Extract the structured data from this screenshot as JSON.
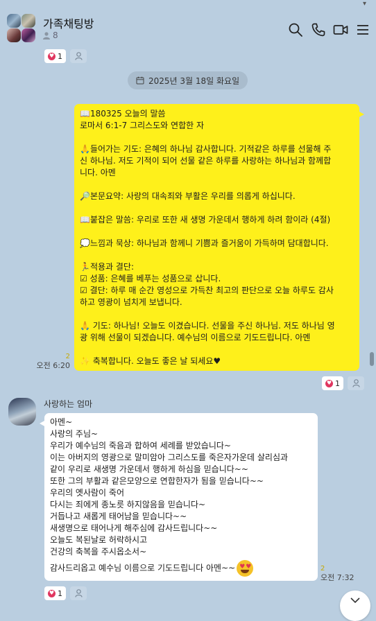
{
  "header": {
    "title": "가족채팅방",
    "member_count": "8",
    "top_scroll_glyph": "▾",
    "icons": [
      "search-icon",
      "phone-icon",
      "video-call-icon",
      "menu-icon"
    ]
  },
  "reactions": {
    "top": {
      "heart_count": "1"
    },
    "msg1": {
      "heart_count": "1"
    },
    "msg2": {
      "heart_count": "1"
    }
  },
  "date_divider": "2025년 3월 18일 화요일",
  "message1": {
    "unread": "2",
    "time": "오전 6:20",
    "paragraphs": [
      "📖180325 오늘의 말씀\n로마서 6:1-7 그리스도와 연합한 자",
      "🙏들어가는 기도: 은혜의 하나님 감사합니다. 기적같은 하루를 선물해 주\n신 하나님. 저도 기적이 되어 선물 같은 하루를 사랑하는 하나님과 함께합\n니다. 아멘",
      "🔎본문요약: 사랑의 대속죄와 부활은 우리를 의롭게 하십니다.",
      "📖붙잡은 말씀: 우리로 또한 새 생명 가운데서 행하게 하려 함이라 (4절)",
      "💭느낌과 묵상: 하나님과 함께니 기쁨과 즐거움이 가득하며 담대합니다.",
      "🏃적용과 결단:\n☑ 성품: 은혜를 베푸는 성품으로 삽니다.\n☑ 결단: 하루 매 순간 영성으로 가득찬 최고의 판단으로 오늘 하루도 감사\n하고 영광이 넘치게 보냅니다.",
      "🙏 기도: 하나님! 오늘도 이겼습니다. 선물을 주신 하나님. 저도 하나님 영\n광 위해 선물이 되겠습니다. 예수님의 이름으로 기도드립니다. 아멘",
      "✨ 축복합니다. 오늘도 좋은 날 되세요♥"
    ]
  },
  "message2": {
    "sender": "사랑하는 엄마",
    "unread": "2",
    "time": "오전 7:32",
    "lines": [
      "아멘~",
      "사랑의 주님~",
      "우리가 예수님의 죽음과 합하여 세례를 받았습니다~",
      "이는 아버지의 영광으로 말미암아 그리스도를 죽은자가운데 살리심과",
      "같이 우리로 새생명 가운데서 행하게 하심을 믿습니다~~",
      "또한 그의 부활과 같은모양으로 연합한자가 됨을 믿습니다~~",
      "우리의 옛사람이 죽어",
      "다시는 죄에게 종노릇 하지않음을 믿습니다~",
      "거듭나고 새롭게 태어남을 믿습니다~~",
      "새생명으로 태어나게 해주심에 감사드립니다~~",
      "오늘도 복된날로 허락하시고",
      "건강의 축복을 주시옵소서~"
    ],
    "last_line": "감사드리옵고 예수님 이름으로 기도드립니다 아멘~~",
    "emoji": "heart-eyes-emoji"
  },
  "colors": {
    "background": "#bacee0",
    "my_bubble": "#fef01b",
    "other_bubble": "#ffffff",
    "heart": "#e0365f",
    "unread": "#c5a800"
  }
}
